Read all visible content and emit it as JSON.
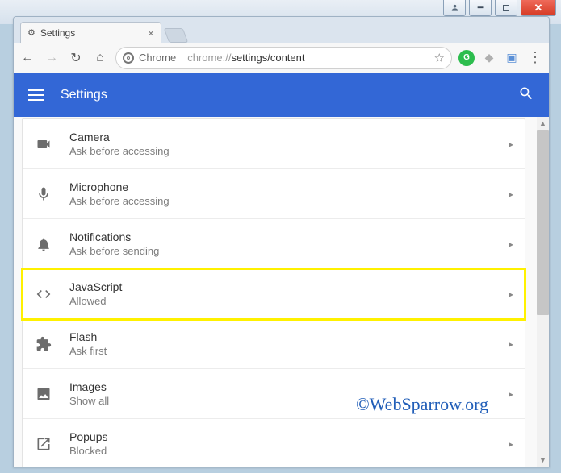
{
  "window": {
    "minimize_tooltip": "Minimize",
    "maximize_tooltip": "Maximize",
    "close_tooltip": "Close"
  },
  "tab": {
    "title": "Settings"
  },
  "toolbar": {
    "chrome_label": "Chrome",
    "url_prefix": "chrome://",
    "url_path": "settings/content"
  },
  "header": {
    "title": "Settings"
  },
  "items": [
    {
      "title": "Camera",
      "sub": "Ask before accessing",
      "icon": "camera"
    },
    {
      "title": "Microphone",
      "sub": "Ask before accessing",
      "icon": "microphone"
    },
    {
      "title": "Notifications",
      "sub": "Ask before sending",
      "icon": "notifications"
    },
    {
      "title": "JavaScript",
      "sub": "Allowed",
      "icon": "code",
      "highlight": true
    },
    {
      "title": "Flash",
      "sub": "Ask first",
      "icon": "flash"
    },
    {
      "title": "Images",
      "sub": "Show all",
      "icon": "images"
    },
    {
      "title": "Popups",
      "sub": "Blocked",
      "icon": "popups"
    }
  ],
  "watermark": "©WebSparrow.org"
}
